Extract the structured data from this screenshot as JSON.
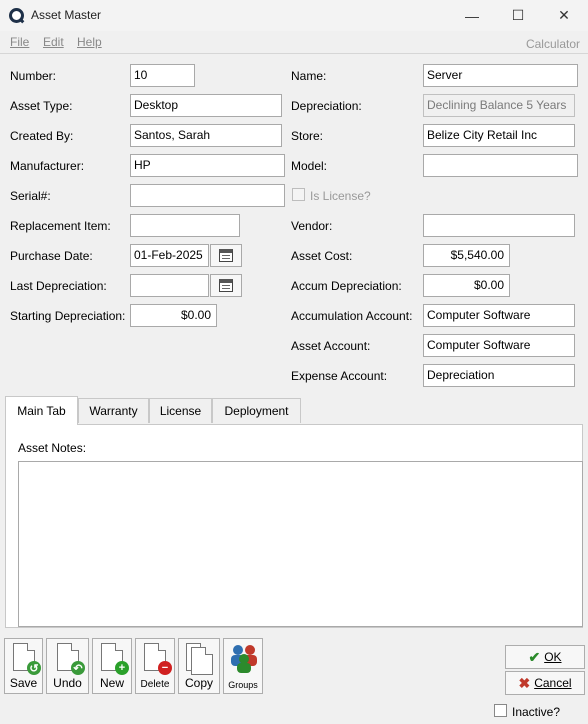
{
  "window": {
    "title": "Asset Master",
    "minimize": "—",
    "maximize": "☐",
    "close": "✕"
  },
  "menu": {
    "file": "File",
    "edit": "Edit",
    "help": "Help",
    "calculator": "Calculator"
  },
  "form": {
    "number": {
      "label": "Number:",
      "value": "10"
    },
    "asset_type": {
      "label": "Asset Type:",
      "value": "Desktop"
    },
    "created_by": {
      "label": "Created By:",
      "value": "Santos, Sarah"
    },
    "manufacturer": {
      "label": "Manufacturer:",
      "value": "HP"
    },
    "serial": {
      "label": "Serial#:",
      "value": ""
    },
    "replacement_item": {
      "label": "Replacement Item:",
      "value": ""
    },
    "purchase_date": {
      "label": "Purchase Date:",
      "value": "01-Feb-2025"
    },
    "last_depreciation": {
      "label": "Last Depreciation:",
      "value": ""
    },
    "starting_depreciation": {
      "label": "Starting Depreciation:",
      "value": "$0.00"
    },
    "name": {
      "label": "Name:",
      "value": "Server"
    },
    "depreciation": {
      "label": "Depreciation:",
      "value": "Declining Balance 5 Years"
    },
    "store": {
      "label": "Store:",
      "value": "Belize City Retail Inc"
    },
    "model": {
      "label": "Model:",
      "value": ""
    },
    "is_license": {
      "label": "Is License?",
      "checked": false
    },
    "vendor": {
      "label": "Vendor:",
      "value": ""
    },
    "asset_cost": {
      "label": "Asset Cost:",
      "value": "$5,540.00"
    },
    "accum_depreciation": {
      "label": "Accum Depreciation:",
      "value": "$0.00"
    },
    "accumulation_account": {
      "label": "Accumulation Account:",
      "value": "Computer Software"
    },
    "asset_account": {
      "label": "Asset Account:",
      "value": "Computer Software"
    },
    "expense_account": {
      "label": "Expense Account:",
      "value": "Depreciation"
    }
  },
  "tabs": [
    {
      "label": "Main Tab",
      "active": true
    },
    {
      "label": "Warranty",
      "active": false
    },
    {
      "label": "License",
      "active": false
    },
    {
      "label": "Deployment",
      "active": false
    }
  ],
  "main_tab": {
    "notes_label": "Asset Notes:",
    "notes_value": ""
  },
  "toolbar": {
    "save": "Save",
    "undo": "Undo",
    "new": "New",
    "delete": "Delete",
    "copy": "Copy",
    "groups": "Groups"
  },
  "actions": {
    "ok": "OK",
    "cancel": "Cancel",
    "inactive": "Inactive?"
  },
  "colors": {
    "ok_check": "#2a8a2a",
    "cancel_x": "#c0392b",
    "save_badge": "#3a9a3a",
    "new_badge": "#2aa02a",
    "delete_badge": "#d02020"
  }
}
